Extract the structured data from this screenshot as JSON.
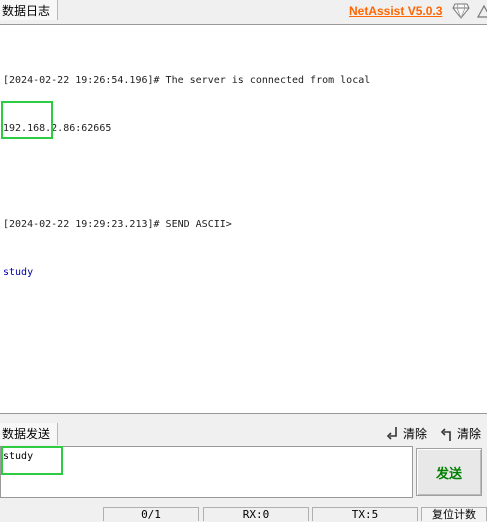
{
  "header": {
    "tab_label": "数据日志",
    "app_name": "NetAssist V5.0.3",
    "accent_color": "#ff6600",
    "icons": [
      "diamond-icon",
      "help-icon"
    ]
  },
  "receive": {
    "lines": [
      "[2024-02-22 19:26:54.196]# The server is connected from local",
      "192.168.2.86:62665",
      "",
      "[2024-02-22 19:29:23.213]# SEND ASCII>",
      "study"
    ]
  },
  "send": {
    "tab_label": "数据发送",
    "clear_label_1": "清除",
    "clear_label_2": "清除",
    "input_value": "study",
    "send_button": "发送",
    "send_button_color": "#008000"
  },
  "status": {
    "count": "0/1",
    "rx": "RX:0",
    "tx": "TX:5",
    "reset": "复位计数"
  },
  "highlight_color": "#2ecc40"
}
